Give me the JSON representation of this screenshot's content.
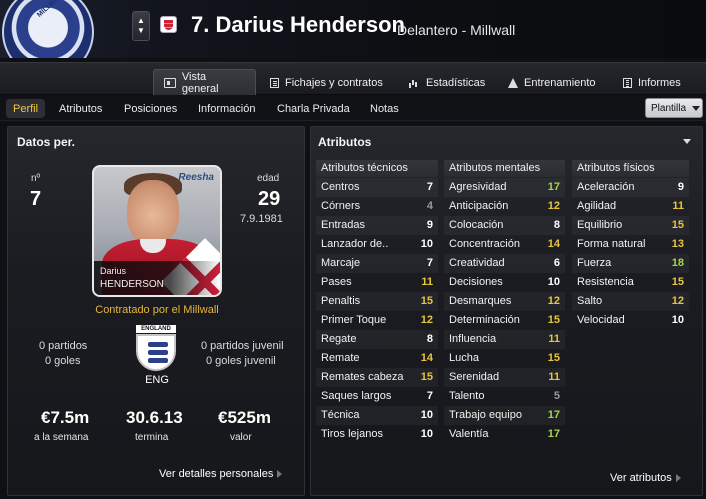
{
  "header": {
    "club_crest_label": "MILLWALL F.C.",
    "stepper_up": "▲",
    "stepper_down": "▼",
    "title": "7. Darius Henderson",
    "subtitle": "Delantero - Millwall"
  },
  "tabs": [
    {
      "label": "Vista general",
      "icon": "profile-card-icon",
      "active": true
    },
    {
      "label": "Fichajes y contratos",
      "icon": "document-icon",
      "active": false
    },
    {
      "label": "Estadísticas",
      "icon": "bar-chart-icon",
      "active": false
    },
    {
      "label": "Entrenamiento",
      "icon": "training-cone-icon",
      "active": false
    },
    {
      "label": "Informes",
      "icon": "report-icon",
      "active": false
    }
  ],
  "subnav": [
    {
      "label": "Perfil",
      "active": true
    },
    {
      "label": "Atributos",
      "active": false
    },
    {
      "label": "Posiciones",
      "active": false
    },
    {
      "label": "Información",
      "active": false
    },
    {
      "label": "Charla Privada",
      "active": false
    },
    {
      "label": "Notas",
      "active": false
    }
  ],
  "squad_dropdown": {
    "label": "Plantilla"
  },
  "personal": {
    "title": "Datos per.",
    "number_label": "nº",
    "number": "7",
    "age_label": "edad",
    "age": "29",
    "dob": "7.9.1981",
    "photo_caption_first": "Darius",
    "photo_caption_last": "HENDERSON",
    "photo_logo": "Reesha",
    "contract": "Contratado por el Millwall",
    "senior_apps": "0 partidos",
    "senior_goals": "0 goles",
    "youth_apps": "0 partidos juvenil",
    "youth_goals": "0 goles juvenil",
    "badge_text": "ENGLAND",
    "nationality": "ENG",
    "wage": "€7.5m",
    "wage_label": "a la semana",
    "contract_end": "30.6.13",
    "contract_end_label": "termina",
    "value": "€525m",
    "value_label": "valor",
    "details_link": "Ver detalles personales"
  },
  "attributes": {
    "title": "Atributos",
    "link": "Ver atributos",
    "colors": {
      "high": "#e9c43c",
      "mid": "#ffffff",
      "low": "#9a9a9a",
      "green": "#a6d64a"
    },
    "technical": {
      "title": "Atributos técnicos",
      "rows": [
        {
          "name": "Centros",
          "value": "7",
          "tier": "mid"
        },
        {
          "name": "Córners",
          "value": "4",
          "tier": "low"
        },
        {
          "name": "Entradas",
          "value": "9",
          "tier": "mid"
        },
        {
          "name": "Lanzador de..",
          "value": "10",
          "tier": "mid"
        },
        {
          "name": "Marcaje",
          "value": "7",
          "tier": "mid"
        },
        {
          "name": "Pases",
          "value": "11",
          "tier": "high"
        },
        {
          "name": "Penaltis",
          "value": "15",
          "tier": "high"
        },
        {
          "name": "Primer Toque",
          "value": "12",
          "tier": "high"
        },
        {
          "name": "Regate",
          "value": "8",
          "tier": "mid"
        },
        {
          "name": "Remate",
          "value": "14",
          "tier": "high"
        },
        {
          "name": "Remates cabeza",
          "value": "15",
          "tier": "high"
        },
        {
          "name": "Saques largos",
          "value": "7",
          "tier": "mid"
        },
        {
          "name": "Técnica",
          "value": "10",
          "tier": "mid"
        },
        {
          "name": "Tiros lejanos",
          "value": "10",
          "tier": "mid"
        }
      ]
    },
    "mental": {
      "title": "Atributos mentales",
      "rows": [
        {
          "name": "Agresividad",
          "value": "17",
          "tier": "green"
        },
        {
          "name": "Anticipación",
          "value": "12",
          "tier": "high"
        },
        {
          "name": "Colocación",
          "value": "8",
          "tier": "mid"
        },
        {
          "name": "Concentración",
          "value": "14",
          "tier": "high"
        },
        {
          "name": "Creatividad",
          "value": "6",
          "tier": "mid"
        },
        {
          "name": "Decisiones",
          "value": "10",
          "tier": "mid"
        },
        {
          "name": "Desmarques",
          "value": "12",
          "tier": "high"
        },
        {
          "name": "Determinación",
          "value": "15",
          "tier": "high"
        },
        {
          "name": "Influencia",
          "value": "11",
          "tier": "high"
        },
        {
          "name": "Lucha",
          "value": "15",
          "tier": "high"
        },
        {
          "name": "Serenidad",
          "value": "11",
          "tier": "high"
        },
        {
          "name": "Talento",
          "value": "5",
          "tier": "low"
        },
        {
          "name": "Trabajo equipo",
          "value": "17",
          "tier": "green"
        },
        {
          "name": "Valentía",
          "value": "17",
          "tier": "green"
        }
      ]
    },
    "physical": {
      "title": "Atributos físicos",
      "rows": [
        {
          "name": "Aceleración",
          "value": "9",
          "tier": "mid"
        },
        {
          "name": "Agilidad",
          "value": "11",
          "tier": "high"
        },
        {
          "name": "Equilibrio",
          "value": "15",
          "tier": "high"
        },
        {
          "name": "Forma natural",
          "value": "13",
          "tier": "high"
        },
        {
          "name": "Fuerza",
          "value": "18",
          "tier": "green"
        },
        {
          "name": "Resistencia",
          "value": "15",
          "tier": "high"
        },
        {
          "name": "Salto",
          "value": "12",
          "tier": "high"
        },
        {
          "name": "Velocidad",
          "value": "10",
          "tier": "mid"
        }
      ]
    }
  }
}
